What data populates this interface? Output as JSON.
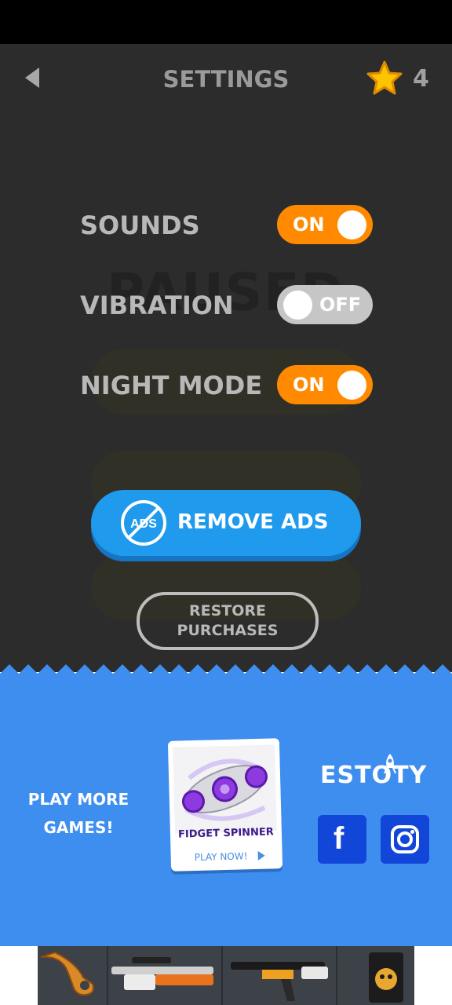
{
  "colors": {
    "panel_bg": "#2c2c2c",
    "toggle_on": "#ff8a00",
    "toggle_off": "#c6c6c6",
    "remove_ads_bg": "#1f9aec",
    "promo_bg": "#3e8ef0",
    "social_bg": "#1246d8",
    "star": "#ffc400"
  },
  "header": {
    "title": "SETTINGS",
    "star_count": "4",
    "back_icon": "back-arrow-icon",
    "star_icon": "star-icon"
  },
  "background_text": "PAUSED",
  "settings": [
    {
      "label": "SOUNDS",
      "state": "ON",
      "on": true
    },
    {
      "label": "VIBRATION",
      "state": "OFF",
      "on": false
    },
    {
      "label": "NIGHT MODE",
      "state": "ON",
      "on": true
    }
  ],
  "remove_ads": {
    "label": "REMOVE ADS",
    "icon_text": "ADS",
    "icon": "no-ads-icon"
  },
  "restore": {
    "line1": "RESTORE",
    "line2": "PURCHASES"
  },
  "promo": {
    "play_more_line1": "PLAY MORE",
    "play_more_line2": "GAMES!",
    "game_name": "FIDGET SPINNER",
    "play_now": "PLAY NOW!",
    "brand": "ESTOTY",
    "social": [
      {
        "name": "facebook",
        "icon": "facebook-icon",
        "glyph": "f"
      },
      {
        "name": "instagram",
        "icon": "instagram-icon"
      }
    ]
  },
  "ad_banner": {
    "items": [
      "knife",
      "sniper-rifle",
      "assault-rifle",
      "sticker-pack"
    ]
  }
}
